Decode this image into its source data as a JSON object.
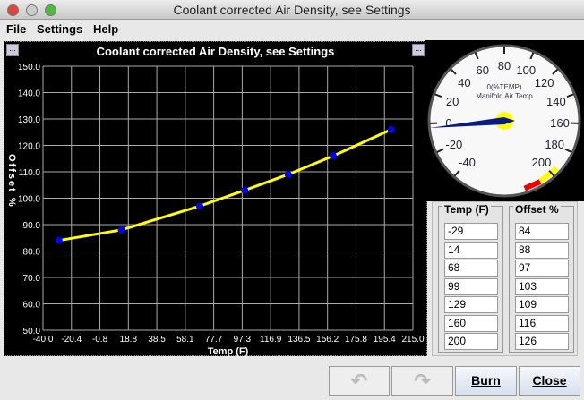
{
  "window": {
    "title": "Coolant corrected Air Density, see Settings"
  },
  "menu": [
    "File",
    "Settings",
    "Help"
  ],
  "chart_data": {
    "type": "line",
    "title": "Coolant corrected Air Density, see Settings",
    "xlabel": "Temp (F)",
    "ylabel": "Offset %",
    "xlim": [
      -40,
      215
    ],
    "ylim": [
      50,
      150
    ],
    "x_ticks": [
      "-40.0",
      "-20.4",
      "-0.8",
      "18.8",
      "38.5",
      "58.1",
      "77.7",
      "97.3",
      "116.9",
      "136.5",
      "156.2",
      "175.8",
      "195.4",
      "215.0"
    ],
    "y_ticks": [
      "50.0",
      "60.0",
      "70.0",
      "80.0",
      "90.0",
      "100.0",
      "110.0",
      "120.0",
      "130.0",
      "140.0",
      "150.0"
    ],
    "x": [
      -29,
      14,
      68,
      99,
      129,
      160,
      200
    ],
    "y": [
      84,
      88,
      97,
      103,
      109,
      116,
      126
    ],
    "line_color": "#ffff00",
    "point_color": "#0000ff"
  },
  "gauge": {
    "title": "0(%TEMP)",
    "subtitle": "Manifold Air Temp",
    "labels": [
      "-40",
      "-20",
      "0",
      "20",
      "40",
      "60",
      "80",
      "100",
      "120",
      "140",
      "160",
      "180",
      "200"
    ],
    "value": -3
  },
  "table": {
    "col1_header": "Temp (F)",
    "col2_header": "Offset %",
    "temps": [
      "-29",
      "14",
      "68",
      "99",
      "129",
      "160",
      "200"
    ],
    "offsets": [
      "84",
      "88",
      "97",
      "103",
      "109",
      "116",
      "126"
    ]
  },
  "buttons": {
    "undo": "↶",
    "redo": "↷",
    "burn": "Burn",
    "close": "Close"
  }
}
